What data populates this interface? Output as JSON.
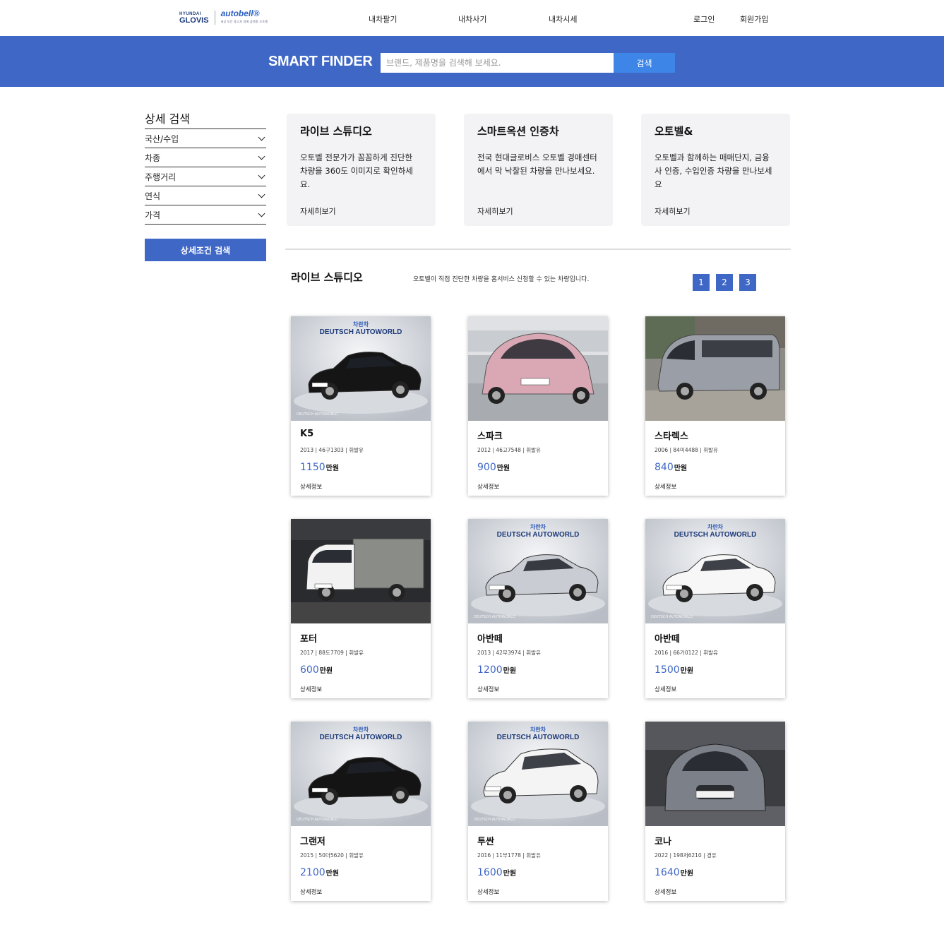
{
  "nav": {
    "logo_hyundai": "HYUNDAI",
    "logo_glovis": "GLOVIS",
    "logo_autobell": "autobell®",
    "logo_tagline": "세상 모든 중고차 경매 플랫폼 오토벨",
    "links": [
      "내차팔기",
      "내차사기",
      "내차시세"
    ],
    "login": "로그인",
    "signup": "회원가입"
  },
  "search": {
    "brand": "SMART FINDER",
    "placeholder": "브랜드, 제품명을 검색해 보세요.",
    "button": "검색"
  },
  "sidebar": {
    "title": "상세 검색",
    "filters": [
      "국산/수입",
      "차종",
      "주행거리",
      "연식",
      "가격"
    ],
    "button": "상세조건 검색"
  },
  "promos": [
    {
      "title": "라이브 스튜디오",
      "desc": "오토벨 전문가가 꼼꼼하게 진단한 차량을 360도 이미지로 확인하세요.",
      "more": "자세히보기"
    },
    {
      "title": "스마트옥션 인증차",
      "desc": "전국 현대글로비스 오토벨 경매센터에서 막 낙찰된 차량을 만나보세요.",
      "more": "자세히보기"
    },
    {
      "title": "오토벨&",
      "desc": "오토벨과 함께하는 매매단지, 금융사 인증, 수입인증 차량을 만나보세요",
      "more": "자세히보기"
    }
  ],
  "section": {
    "title": "라이브 스튜디오",
    "desc": "오토벨이 직접 진단한 차량을 홈서비스 신청할 수 있는 차량입니다.",
    "pages": [
      "1",
      "2",
      "3"
    ]
  },
  "watermark": {
    "top": "차란차",
    "brand": "DEUTSCH AUTOWORLD",
    "small": "DEUTSCH AUTOWORLD"
  },
  "cars": [
    {
      "name": "K5",
      "info": "2013 | 46구1303 | 휘발유",
      "price": "1150",
      "unit": "만원",
      "detail": "상세정보",
      "color": "#151515",
      "bg": "studio",
      "type": "sedan",
      "wm": true
    },
    {
      "name": "스파크",
      "info": "2012 | 46고7548 | 휘발유",
      "price": "900",
      "unit": "만원",
      "detail": "상세정보",
      "color": "#d9a8b4",
      "bg": "garage",
      "type": "hatch",
      "wm": false
    },
    {
      "name": "스타렉스",
      "info": "2006 | 84미4488 | 휘발유",
      "price": "840",
      "unit": "만원",
      "detail": "상세정보",
      "color": "#9a9ea6",
      "bg": "outdoor",
      "type": "van",
      "wm": false
    },
    {
      "name": "포터",
      "info": "2017 | 88도7709 | 휘발유",
      "price": "600",
      "unit": "만원",
      "detail": "상세정보",
      "color": "#f2f2f2",
      "bg": "dark",
      "type": "truck",
      "wm": false
    },
    {
      "name": "아반떼",
      "info": "2013 | 42무3974 | 휘발유",
      "price": "1200",
      "unit": "만원",
      "detail": "상세정보",
      "color": "#c9ccd2",
      "bg": "studio",
      "type": "sedan",
      "wm": true
    },
    {
      "name": "아반떼",
      "info": "2016 | 66가0122 | 휘발유",
      "price": "1500",
      "unit": "만원",
      "detail": "상세정보",
      "color": "#f7f7f7",
      "bg": "studio",
      "type": "sedan",
      "wm": true
    },
    {
      "name": "그랜저",
      "info": "2015 | 50더5620 | 휘발유",
      "price": "2100",
      "unit": "만원",
      "detail": "상세정보",
      "color": "#141414",
      "bg": "studio",
      "type": "sedan",
      "wm": true
    },
    {
      "name": "투싼",
      "info": "2016 | 11부1778 | 휘발유",
      "price": "1600",
      "unit": "만원",
      "detail": "상세정보",
      "color": "#f4f4f4",
      "bg": "studio",
      "type": "suv",
      "wm": true
    },
    {
      "name": "코나",
      "info": "2022 | 198저6210 | 경유",
      "price": "1640",
      "unit": "만원",
      "detail": "상세정보",
      "color": "#7c8088",
      "bg": "parking",
      "type": "front",
      "wm": false
    }
  ]
}
